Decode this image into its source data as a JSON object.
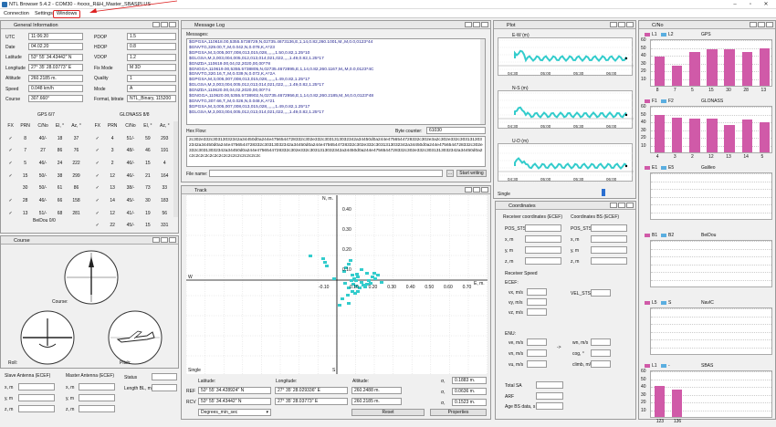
{
  "window": {
    "title": "NTL Browser 5.4.2 - COM30 - #xxxx_R&H_Master_SBASPLUS"
  },
  "menu": {
    "connection": "Connection",
    "settings": "Settings",
    "windows": "Windows"
  },
  "general": {
    "title": "General Information",
    "rows": [
      [
        "UTC",
        "11:06:20",
        "PDOP",
        "1.5"
      ],
      [
        "Date",
        "04.02.20",
        "HDOP",
        "0.8"
      ],
      [
        "Latitude",
        "53° 55' 34.43442\" N",
        "VDOP",
        "1.2"
      ],
      [
        "Longitude",
        "27° 35' 28.03773\" E",
        "Fix Mode",
        "M 3D"
      ],
      [
        "Altitude",
        "260.2185 m.",
        "Quality",
        "1"
      ],
      [
        "Speed",
        "0.048 km/h",
        "Mode",
        "A"
      ],
      [
        "Course",
        "307.660°",
        "Format, bitrate",
        "NTL_Binary, 115200"
      ]
    ],
    "gps_header": "GPS 6/7",
    "glonass_header": "GLONASS 8/8",
    "cols": [
      "FX",
      "PRN",
      "C/No",
      "El, °",
      "Az, °"
    ],
    "gps": [
      [
        "✓",
        "8",
        "40/-",
        "18",
        "37"
      ],
      [
        "✓",
        "7",
        "27",
        "86",
        "76"
      ],
      [
        "✓",
        "5",
        "46/-",
        "24",
        "222"
      ],
      [
        "✓",
        "15",
        "50/-",
        "38",
        "299"
      ],
      [
        "",
        "30",
        "50/-",
        "61",
        "86"
      ],
      [
        "✓",
        "28",
        "46/-",
        "66",
        "158"
      ],
      [
        "✓",
        "13",
        "51/-",
        "68",
        "281"
      ]
    ],
    "glonass": [
      [
        "✓",
        "4",
        "51/-",
        "59",
        "293"
      ],
      [
        "✓",
        "3",
        "48/-",
        "46",
        "191"
      ],
      [
        "✓",
        "2",
        "46/-",
        "15",
        "4"
      ],
      [
        "✓",
        "12",
        "46/-",
        "21",
        "164"
      ],
      [
        "✓",
        "13",
        "38/-",
        "73",
        "33"
      ],
      [
        "✓",
        "14",
        "45/-",
        "30",
        "183"
      ],
      [
        "✓",
        "12",
        "41/-",
        "19",
        "56"
      ],
      [
        "✓",
        "22",
        "45/-",
        "15",
        "331"
      ]
    ],
    "beidou_header": "BeiDou 0/0"
  },
  "course": {
    "title": "Course",
    "course_label": "Course:",
    "roll_label": "Roll:",
    "pitch_label": "Pitch:",
    "course_deg": 307.66
  },
  "antenna": {
    "slave": "Slave Antenna (ECEF)",
    "master": "Master Antenna (ECEF)",
    "x": "x, m",
    "y": "y, m",
    "z": "z, m",
    "status": "Status",
    "length": "Length BL, m"
  },
  "msglog": {
    "title": "Message Log",
    "messages_label": "Messages:",
    "lines": [
      "$GPGSA,110618.00,5355.5738729,N,02735.4673136,E,1,14,0.82,260.1001,M,,M,0.0,0123*44",
      "$GNVTG,329.00,T,,M,0.042,N,0.078,K,A*23",
      "$GPGSA,M,3,005,007,008,013,015,028,,,,,,,1.50,0.82,1.25*10",
      "$GLGSA,M,3,003,004,005,012,013,014,021,022,,,,,1.49,0.82,1.25*17",
      "$GNZDA,110619.00,04,02,2020,00,00*78",
      "$GNGGA,110619.00,5355.5738805,N,02735.4672895,E,1,14,0.82,260.1167,M,,M,0.0,0123*4C",
      "$GNVTG,320.16,T,,M,0.039,N,0.072,K,A*2A",
      "$GPGSA,M,3,005,007,008,013,015,028,,,,,,,1.49,0.82,1.25*17",
      "$GLGSA,M,3,003,004,005,012,013,014,021,022,,,,,1.49,0.82,1.25*17",
      "$GNZDA,110620.00,04,02,2020,00,00*74",
      "$GNGGA,110620.00,5355.5738902,N,02735.4672956,E,1,14,0.82,260.2185,M,,M,0.0,0123*48",
      "$GNVTG,307.66,T,,M,0.026,N,0.048,K,A*21",
      "$GPGSA,M,3,005,007,008,013,015,028,,,,,,,1.49,0.82,1.25*17",
      "$GLGSA,M,3,003,004,005,012,013,014,021,022,,,,,1.49,0.82,1.25*17"
    ],
    "hexflow_label": "Hex Flow:",
    "byte_counter_label": "Byte counter:",
    "byte_counter": "61030",
    "hex": "2c302e332c30313032342a34450d0a244e4756544728332c302e332c3031313032342a34450d0a244e4756544728332c302e3a2c302e332c3031313032342a34450d0a244e4756544728332c30313032342a34450d0a244e4756544728332c302e332c3031313032342a34450d0a244e4756544728332c302e332c30313032342a34450d0a244e4756544728332c302e332c3031313032342a34450d0a244e4756544728332c302e332c3031313032342a34450d0a2c2c2c2c2c2c2c2c2c2c2c2c2c2c2c2c",
    "filename_label": "File name:",
    "start_writing": "Start writing"
  },
  "track": {
    "title": "Track",
    "n_label": "N, m.",
    "e_label": "E, m.",
    "w": "W",
    "s": "S",
    "single": "Single",
    "yticks": [
      "0.40",
      "0.30",
      "0.20",
      "0.10"
    ],
    "xticks_neg": [
      "-0.10"
    ],
    "xticks": [
      "0.10",
      "0.20",
      "0.30",
      "0.40",
      "0.50",
      "0.60",
      "0.70"
    ],
    "lat_h": "Latitude:",
    "lon_h": "Longitude:",
    "alt_h": "Altitude:",
    "ref": "REF",
    "rcv": "RCV",
    "ref_lat": "53° 55' 34.428924\" N",
    "ref_lon": "27° 35' 28.029336\" E",
    "ref_alt": "260.2488 m.",
    "rcv_lat": "53° 55' 34.43442\" N",
    "rcv_lon": "27° 35' 28.03773\" E",
    "rcv_alt": "260.2185 m.",
    "s_lat": "σ,",
    "s_lon": "σ,",
    "s_alt": "σ,",
    "sig1": "0.1883 m.",
    "sig2": "0.0636 m.",
    "sig3": "0.1523 m.",
    "format": "Degrees_min_sec",
    "reset": "Reset",
    "properties": "Properties"
  },
  "plot": {
    "title": "Plot",
    "ew": "E-W (m)",
    "ns": "N-S (m)",
    "ud": "U-D (m)",
    "xt": [
      "04:30",
      "05:00",
      "05:30",
      "06:00"
    ],
    "single": "Single"
  },
  "coords": {
    "title": "Coordinates",
    "rcv": "Receiver coordinates (ECEF)",
    "bs": "Coordinates BS (ECEF)",
    "pos_sts": "POS_STS",
    "x": "x, m",
    "y": "y, m",
    "z": "z, m",
    "speed": "Receiver Speed",
    "ecef": "ECEF:",
    "vx": "vx, m/s",
    "vy": "vy, m/s",
    "vz": "vz, m/s",
    "vel_sts": "VEL_STS",
    "enu": "ENU:",
    "ve": "ve, m/s",
    "vn": "vn, m/s",
    "vu": "vu, m/s",
    "wn": "wn, m/s",
    "cog": "cog, °",
    "climb": "climb, m/s",
    "total": "Total SA",
    "arf": "ARF",
    "age": "Age BS data, s",
    "arrow": "->"
  },
  "cno": {
    "title": "C/No",
    "gps": {
      "name": "GPS",
      "legend": [
        "L1",
        "L2"
      ],
      "labels": [
        "8",
        "7",
        "5",
        "15",
        "30",
        "28",
        "13"
      ],
      "values": [
        40,
        27,
        46,
        50,
        50,
        46,
        51
      ]
    },
    "glonass": {
      "name": "GLONASS",
      "legend": [
        "F1",
        "F2"
      ],
      "labels": [
        "4",
        "3",
        "2",
        "12",
        "13",
        "14",
        "5"
      ],
      "values": [
        51,
        48,
        46,
        46,
        38,
        45,
        41
      ]
    },
    "galileo": {
      "name": "Galileo",
      "legend": [
        "E1",
        "E5"
      ]
    },
    "beidou": {
      "name": "BeiDou",
      "legend": [
        "B1",
        "B2"
      ]
    },
    "navic": {
      "name": "NavIC",
      "legend": [
        "L5",
        "S"
      ]
    },
    "sbas": {
      "name": "SBAS",
      "legend": [
        "L1",
        "-"
      ],
      "labels": [
        "123",
        "136"
      ],
      "values": [
        42,
        38
      ]
    },
    "yticks": [
      "60",
      "50",
      "40",
      "30",
      "20",
      "10"
    ],
    "accent": "#d05aa8"
  }
}
